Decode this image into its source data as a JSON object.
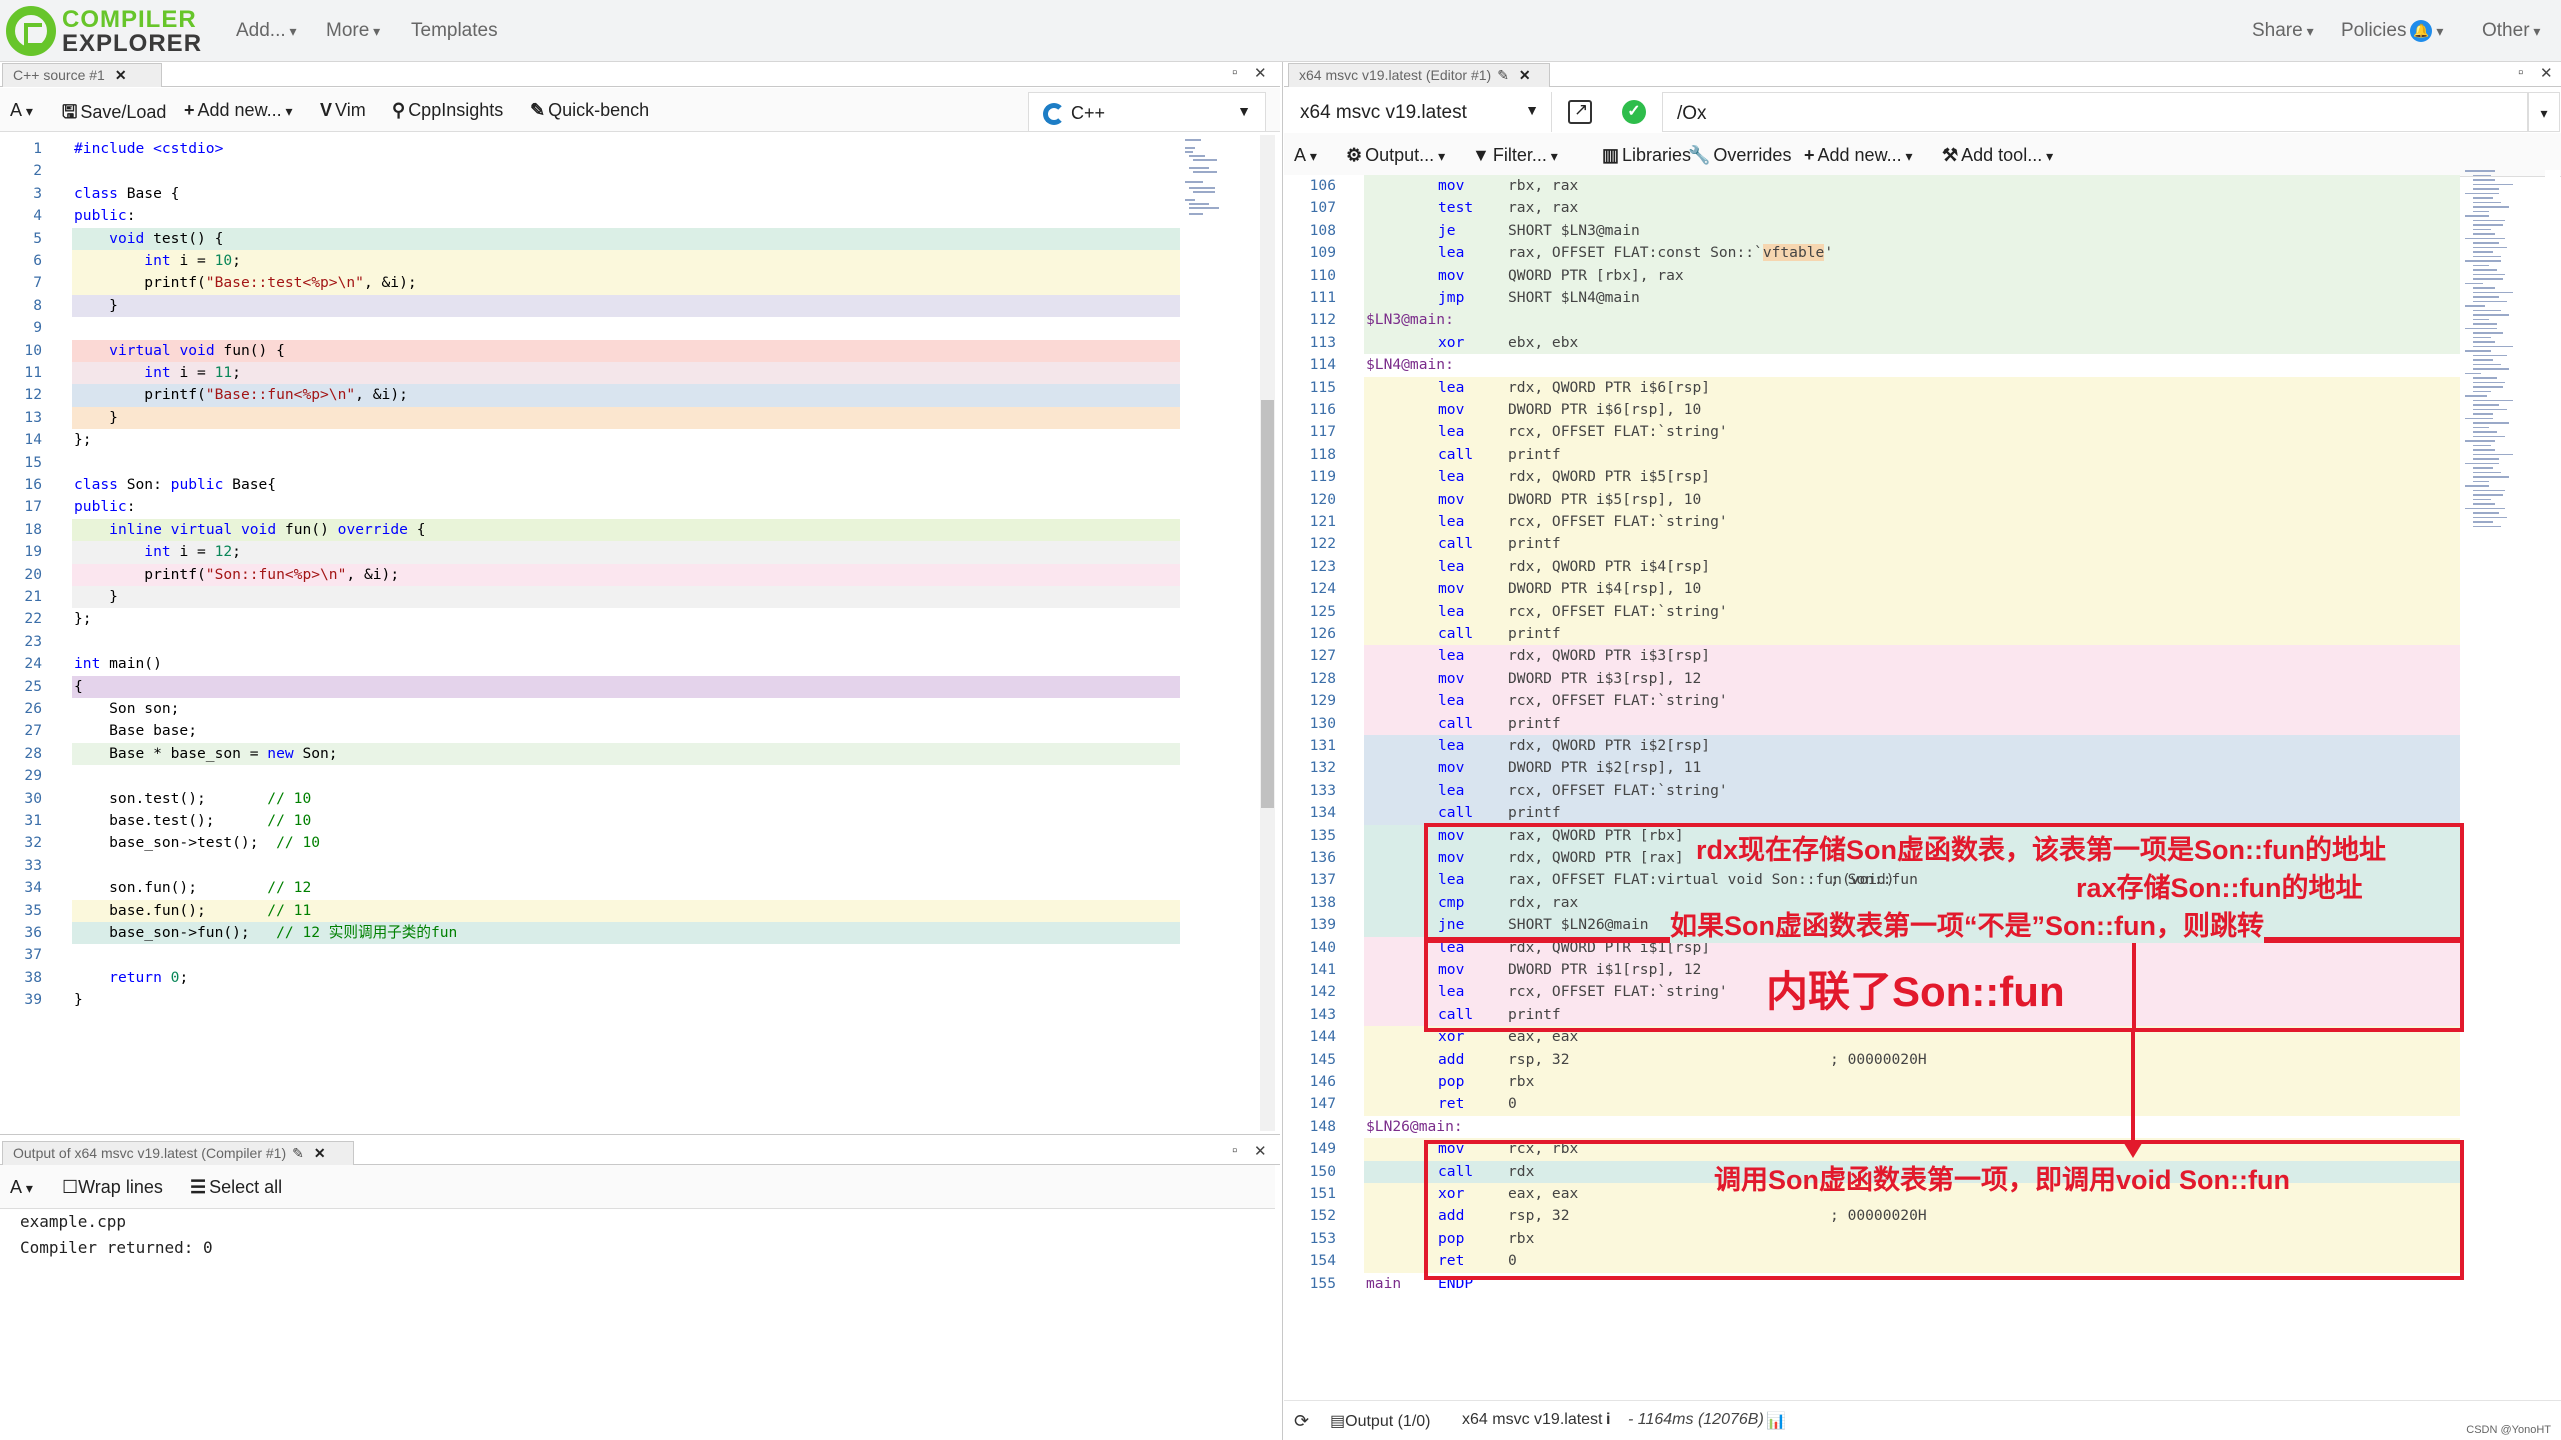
{
  "nav": {
    "logo_line1": "COMPILER",
    "logo_line2": "EXPLORER",
    "add": "Add...",
    "more": "More",
    "templates": "Templates",
    "share": "Share",
    "policies": "Policies",
    "other": "Other",
    "colors": {
      "logo_green": "#67c52a",
      "policy_badge": "#1f8ceb"
    }
  },
  "source_pane": {
    "tab_title": "C++ source #1",
    "toolbar": {
      "font_btn": "A",
      "save_load": "Save/Load",
      "add_new": "Add new...",
      "vim": "Vim",
      "cppinsights": "CppInsights",
      "quickbench": "Quick-bench"
    },
    "language": "C++",
    "lines": [
      {
        "n": "1",
        "segs": [
          [
            "pp",
            "#include <cstdio>"
          ]
        ]
      },
      {
        "n": "2",
        "segs": []
      },
      {
        "n": "3",
        "segs": [
          [
            "kw",
            "class"
          ],
          [
            "t",
            " Base {"
          ]
        ]
      },
      {
        "n": "4",
        "segs": [
          [
            "kw",
            "public"
          ],
          [
            "t",
            ":"
          ]
        ]
      },
      {
        "n": "5",
        "segs": [
          [
            "t",
            "    "
          ],
          [
            "kw",
            "void"
          ],
          [
            "t",
            " test() {"
          ]
        ]
      },
      {
        "n": "6",
        "segs": [
          [
            "t",
            "        "
          ],
          [
            "kw",
            "int"
          ],
          [
            "t",
            " i = "
          ],
          [
            "num",
            "10"
          ],
          [
            "t",
            ";"
          ]
        ]
      },
      {
        "n": "7",
        "segs": [
          [
            "t",
            "        printf("
          ],
          [
            "str",
            "\"Base::test<%p>\\n\""
          ],
          [
            "t",
            ", &i);"
          ]
        ]
      },
      {
        "n": "8",
        "segs": [
          [
            "t",
            "    }"
          ]
        ]
      },
      {
        "n": "9",
        "segs": []
      },
      {
        "n": "10",
        "segs": [
          [
            "t",
            "    "
          ],
          [
            "kw",
            "virtual"
          ],
          [
            "t",
            " "
          ],
          [
            "kw",
            "void"
          ],
          [
            "t",
            " fun() {"
          ]
        ]
      },
      {
        "n": "11",
        "segs": [
          [
            "t",
            "        "
          ],
          [
            "kw",
            "int"
          ],
          [
            "t",
            " i = "
          ],
          [
            "num",
            "11"
          ],
          [
            "t",
            ";"
          ]
        ]
      },
      {
        "n": "12",
        "segs": [
          [
            "t",
            "        printf("
          ],
          [
            "str",
            "\"Base::fun<%p>\\n\""
          ],
          [
            "t",
            ", &i);"
          ]
        ]
      },
      {
        "n": "13",
        "segs": [
          [
            "t",
            "    }"
          ]
        ]
      },
      {
        "n": "14",
        "segs": [
          [
            "t",
            "};"
          ]
        ]
      },
      {
        "n": "15",
        "segs": []
      },
      {
        "n": "16",
        "segs": [
          [
            "kw",
            "class"
          ],
          [
            "t",
            " Son: "
          ],
          [
            "kw",
            "public"
          ],
          [
            "t",
            " Base{"
          ]
        ]
      },
      {
        "n": "17",
        "segs": [
          [
            "kw",
            "public"
          ],
          [
            "t",
            ":"
          ]
        ]
      },
      {
        "n": "18",
        "segs": [
          [
            "t",
            "    "
          ],
          [
            "kw",
            "inline"
          ],
          [
            "t",
            " "
          ],
          [
            "kw",
            "virtual"
          ],
          [
            "t",
            " "
          ],
          [
            "kw",
            "void"
          ],
          [
            "t",
            " fun() "
          ],
          [
            "kw",
            "override"
          ],
          [
            "t",
            " {"
          ]
        ]
      },
      {
        "n": "19",
        "segs": [
          [
            "t",
            "        "
          ],
          [
            "kw",
            "int"
          ],
          [
            "t",
            " i = "
          ],
          [
            "num",
            "12"
          ],
          [
            "t",
            ";"
          ]
        ]
      },
      {
        "n": "20",
        "segs": [
          [
            "t",
            "        printf("
          ],
          [
            "str",
            "\"Son::fun<%p>\\n\""
          ],
          [
            "t",
            ", &i);"
          ]
        ]
      },
      {
        "n": "21",
        "segs": [
          [
            "t",
            "    }"
          ]
        ]
      },
      {
        "n": "22",
        "segs": [
          [
            "t",
            "};"
          ]
        ]
      },
      {
        "n": "23",
        "segs": []
      },
      {
        "n": "24",
        "segs": [
          [
            "kw",
            "int"
          ],
          [
            "t",
            " main()"
          ]
        ]
      },
      {
        "n": "25",
        "segs": [
          [
            "t",
            "{"
          ]
        ]
      },
      {
        "n": "26",
        "segs": [
          [
            "t",
            "    Son son;"
          ]
        ]
      },
      {
        "n": "27",
        "segs": [
          [
            "t",
            "    Base base;"
          ]
        ]
      },
      {
        "n": "28",
        "segs": [
          [
            "t",
            "    Base * base_son = "
          ],
          [
            "kw",
            "new"
          ],
          [
            "t",
            " Son;"
          ]
        ]
      },
      {
        "n": "29",
        "segs": []
      },
      {
        "n": "30",
        "segs": [
          [
            "t",
            "    son.test();       "
          ],
          [
            "cmt",
            "// 10"
          ]
        ]
      },
      {
        "n": "31",
        "segs": [
          [
            "t",
            "    base.test();      "
          ],
          [
            "cmt",
            "// 10"
          ]
        ]
      },
      {
        "n": "32",
        "segs": [
          [
            "t",
            "    base_son->test();  "
          ],
          [
            "cmt",
            "// 10"
          ]
        ]
      },
      {
        "n": "33",
        "segs": []
      },
      {
        "n": "34",
        "segs": [
          [
            "t",
            "    son.fun();        "
          ],
          [
            "cmt",
            "// 12"
          ]
        ]
      },
      {
        "n": "35",
        "segs": [
          [
            "t",
            "    base.fun();       "
          ],
          [
            "cmt",
            "// 11"
          ]
        ]
      },
      {
        "n": "36",
        "segs": [
          [
            "t",
            "    base_son->fun();   "
          ],
          [
            "cmt",
            "// 12 实则调用子类的fun"
          ]
        ]
      },
      {
        "n": "37",
        "segs": []
      },
      {
        "n": "38",
        "segs": [
          [
            "t",
            "    "
          ],
          [
            "kw",
            "return"
          ],
          [
            "t",
            " "
          ],
          [
            "num",
            "0"
          ],
          [
            "t",
            ";"
          ]
        ]
      },
      {
        "n": "39",
        "segs": [
          [
            "t",
            "}"
          ]
        ]
      }
    ],
    "bands": [
      {
        "from": 5,
        "to": 5,
        "color": "#dbefe6"
      },
      {
        "from": 6,
        "to": 7,
        "color": "#fbf8dc"
      },
      {
        "from": 8,
        "to": 8,
        "color": "#e4e2f0"
      },
      {
        "from": 10,
        "to": 10,
        "color": "#fbd9d5"
      },
      {
        "from": 11,
        "to": 11,
        "color": "#f4e6ea"
      },
      {
        "from": 12,
        "to": 12,
        "color": "#d9e4ef"
      },
      {
        "from": 13,
        "to": 13,
        "color": "#fbe6cf"
      },
      {
        "from": 18,
        "to": 18,
        "color": "#e9f4d9"
      },
      {
        "from": 19,
        "to": 19,
        "color": "#f1f1f1"
      },
      {
        "from": 20,
        "to": 20,
        "color": "#fbe6ef"
      },
      {
        "from": 21,
        "to": 21,
        "color": "#f1f1f1"
      },
      {
        "from": 25,
        "to": 25,
        "color": "#e4d3eb"
      },
      {
        "from": 28,
        "to": 28,
        "color": "#e9f4e6"
      },
      {
        "from": 35,
        "to": 35,
        "color": "#fbf8dc"
      },
      {
        "from": 36,
        "to": 36,
        "color": "#d9ede8"
      }
    ]
  },
  "output_pane": {
    "tab_title": "Output of x64 msvc v19.latest (Compiler #1)",
    "wrap_lines": "Wrap lines",
    "select_all": "Select all",
    "line1": "example.cpp",
    "line2": "Compiler returned: 0"
  },
  "compiler_pane": {
    "tab_title": "x64 msvc v19.latest (Editor #1)",
    "compiler": "x64 msvc v19.latest",
    "flags": "/Ox",
    "toolbar": {
      "font_btn": "A",
      "output": "Output...",
      "filter": "Filter...",
      "libraries": "Libraries",
      "overrides": "Overrides",
      "add_new": "Add new...",
      "add_tool": "Add tool..."
    },
    "asm": [
      {
        "n": "106",
        "op": "mov",
        "args": "rbx, rax",
        "bg": "#e9f4e6"
      },
      {
        "n": "107",
        "op": "test",
        "args": "rax, rax",
        "bg": "#e9f4e6"
      },
      {
        "n": "108",
        "op": "je",
        "args": "SHORT $LN3@main",
        "bg": "#e9f4e6"
      },
      {
        "n": "109",
        "op": "lea",
        "args": "rax, OFFSET FLAT:const Son::`",
        "hl": "vftable",
        "tail": "'",
        "bg": "#e9f4e6"
      },
      {
        "n": "110",
        "op": "mov",
        "args": "QWORD PTR [rbx], rax",
        "bg": "#e9f4e6"
      },
      {
        "n": "111",
        "op": "jmp",
        "args": "SHORT $LN4@main",
        "bg": "#e9f4e6"
      },
      {
        "n": "112",
        "label": "$LN3@main:",
        "bg": "#e9f4e6"
      },
      {
        "n": "113",
        "op": "xor",
        "args": "ebx, ebx",
        "bg": "#e9f4e6"
      },
      {
        "n": "114",
        "label": "$LN4@main:"
      },
      {
        "n": "115",
        "op": "lea",
        "args": "rdx, QWORD PTR i$6[rsp]",
        "bg": "#fbf8dc"
      },
      {
        "n": "116",
        "op": "mov",
        "args": "DWORD PTR i$6[rsp], 10",
        "bg": "#fbf8dc"
      },
      {
        "n": "117",
        "op": "lea",
        "args": "rcx, OFFSET FLAT:`string'",
        "bg": "#fbf8dc"
      },
      {
        "n": "118",
        "op": "call",
        "args": "printf",
        "bg": "#fbf8dc"
      },
      {
        "n": "119",
        "op": "lea",
        "args": "rdx, QWORD PTR i$5[rsp]",
        "bg": "#fbf8dc"
      },
      {
        "n": "120",
        "op": "mov",
        "args": "DWORD PTR i$5[rsp], 10",
        "bg": "#fbf8dc"
      },
      {
        "n": "121",
        "op": "lea",
        "args": "rcx, OFFSET FLAT:`string'",
        "bg": "#fbf8dc"
      },
      {
        "n": "122",
        "op": "call",
        "args": "printf",
        "bg": "#fbf8dc"
      },
      {
        "n": "123",
        "op": "lea",
        "args": "rdx, QWORD PTR i$4[rsp]",
        "bg": "#fbf8dc"
      },
      {
        "n": "124",
        "op": "mov",
        "args": "DWORD PTR i$4[rsp], 10",
        "bg": "#fbf8dc"
      },
      {
        "n": "125",
        "op": "lea",
        "args": "rcx, OFFSET FLAT:`string'",
        "bg": "#fbf8dc"
      },
      {
        "n": "126",
        "op": "call",
        "args": "printf",
        "bg": "#fbf8dc"
      },
      {
        "n": "127",
        "op": "lea",
        "args": "rdx, QWORD PTR i$3[rsp]",
        "bg": "#fbe6ef"
      },
      {
        "n": "128",
        "op": "mov",
        "args": "DWORD PTR i$3[rsp], 12",
        "bg": "#fbe6ef"
      },
      {
        "n": "129",
        "op": "lea",
        "args": "rcx, OFFSET FLAT:`string'",
        "bg": "#fbe6ef"
      },
      {
        "n": "130",
        "op": "call",
        "args": "printf",
        "bg": "#fbe6ef"
      },
      {
        "n": "131",
        "op": "lea",
        "args": "rdx, QWORD PTR i$2[rsp]",
        "bg": "#d9e4ef"
      },
      {
        "n": "132",
        "op": "mov",
        "args": "DWORD PTR i$2[rsp], 11",
        "bg": "#d9e4ef"
      },
      {
        "n": "133",
        "op": "lea",
        "args": "rcx, OFFSET FLAT:`string'",
        "bg": "#d9e4ef"
      },
      {
        "n": "134",
        "op": "call",
        "args": "printf",
        "bg": "#d9e4ef"
      },
      {
        "n": "135",
        "op": "mov",
        "args": "rax, QWORD PTR [rbx]",
        "bg": "#d9ede8"
      },
      {
        "n": "136",
        "op": "mov",
        "args": "rdx, QWORD PTR [rax]",
        "bg": "#d9ede8"
      },
      {
        "n": "137",
        "op": "lea",
        "args": "rax, OFFSET FLAT:virtual void Son::fun(void)",
        "cmt": "; Son::fun",
        "bg": "#d9ede8"
      },
      {
        "n": "138",
        "op": "cmp",
        "args": "rdx, rax",
        "bg": "#d9ede8"
      },
      {
        "n": "139",
        "op": "jne",
        "args": "SHORT $LN26@main",
        "bg": "#d9ede8"
      },
      {
        "n": "140",
        "op": "lea",
        "args": "rdx, QWORD PTR i$1[rsp]",
        "bg": "#fbe6ef"
      },
      {
        "n": "141",
        "op": "mov",
        "args": "DWORD PTR i$1[rsp], 12",
        "bg": "#fbe6ef"
      },
      {
        "n": "142",
        "op": "lea",
        "args": "rcx, OFFSET FLAT:`string'",
        "bg": "#fbe6ef"
      },
      {
        "n": "143",
        "op": "call",
        "args": "printf",
        "bg": "#fbe6ef"
      },
      {
        "n": "144",
        "op": "xor",
        "args": "eax, eax",
        "bg": "#fbf8dc"
      },
      {
        "n": "145",
        "op": "add",
        "args": "rsp, 32",
        "cmt": "; 00000020H",
        "bg": "#fbf8dc"
      },
      {
        "n": "146",
        "op": "pop",
        "args": "rbx",
        "bg": "#fbf8dc"
      },
      {
        "n": "147",
        "op": "ret",
        "args": "0",
        "bg": "#fbf8dc"
      },
      {
        "n": "148",
        "label": "$LN26@main:"
      },
      {
        "n": "149",
        "op": "mov",
        "args": "rcx, rbx",
        "bg": "#fbf8dc"
      },
      {
        "n": "150",
        "op": "call",
        "args": "rdx",
        "bg": "#d9ede8"
      },
      {
        "n": "151",
        "op": "xor",
        "args": "eax, eax",
        "bg": "#fbf8dc"
      },
      {
        "n": "152",
        "op": "add",
        "args": "rsp, 32",
        "cmt": "; 00000020H",
        "bg": "#fbf8dc"
      },
      {
        "n": "153",
        "op": "pop",
        "args": "rbx",
        "bg": "#fbf8dc"
      },
      {
        "n": "154",
        "op": "ret",
        "args": "0",
        "bg": "#fbf8dc"
      },
      {
        "n": "155",
        "label": "main",
        "op2": "ENDP"
      }
    ],
    "annotations": {
      "a1": "rdx现在存储Son虚函数表，该表第一项是Son::fun的地址",
      "a2": "rax存储Son::fun的地址",
      "a3": "如果Son虚函数表第一项“不是”Son::fun，则跳转",
      "a4": "内联了Son::fun",
      "a5": "调用Son虚函数表第一项，即调用void  Son::fun",
      "color": "#e2192c"
    },
    "status": {
      "output": "Output (1/0)",
      "compiler": "x64 msvc v19.latest",
      "info_icon": "i",
      "timing": "- 1164ms (12076B)",
      "watermark": "CSDN @YonoHT"
    }
  }
}
